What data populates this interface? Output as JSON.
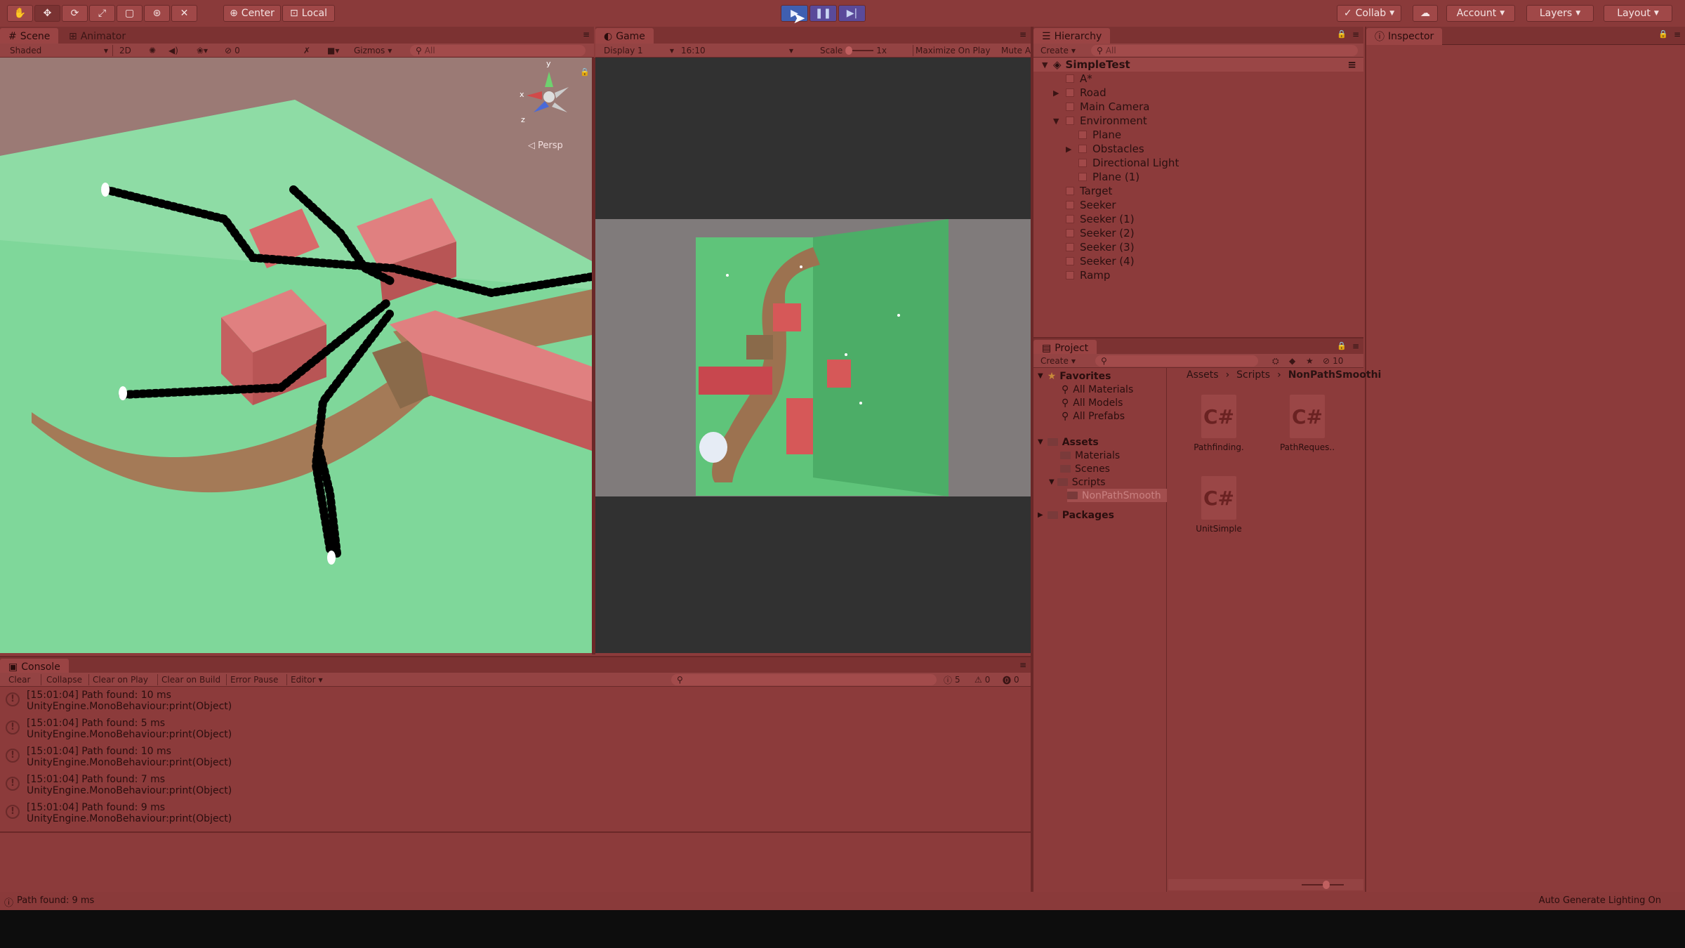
{
  "toolbar": {
    "tools": [
      "hand-tool",
      "move-tool",
      "rotate-tool",
      "scale-tool",
      "rect-tool",
      "transform-tool",
      "custom-tool"
    ],
    "pivot_label": "Center",
    "space_label": "Local",
    "collab_label": "Collab",
    "account_label": "Account",
    "layers_label": "Layers",
    "layout_label": "Layout"
  },
  "scene": {
    "tab_scene": "Scene",
    "tab_animator": "Animator",
    "shading": "Shaded",
    "mode_2d": "2D",
    "fx_count": "0",
    "gizmos": "Gizmos",
    "search_placeholder": "All",
    "persp_label": "Persp",
    "axis_x": "x",
    "axis_y": "y",
    "axis_z": "z"
  },
  "game": {
    "tab": "Game",
    "display": "Display 1",
    "aspect": "16:10",
    "scale_label": "Scale",
    "scale_value": "1x",
    "maximize": "Maximize On Play",
    "mute": "Mute A"
  },
  "hierarchy": {
    "tab": "Hierarchy",
    "create": "Create",
    "search_placeholder": "All",
    "scene_name": "SimpleTest",
    "items": [
      "A*",
      "Road",
      "Main Camera",
      "Environment",
      "Plane",
      "Obstacles",
      "Directional Light",
      "Plane (1)",
      "Target",
      "Seeker",
      "Seeker (1)",
      "Seeker (2)",
      "Seeker (3)",
      "Seeker (4)",
      "Ramp"
    ]
  },
  "inspector": {
    "tab": "Inspector"
  },
  "project": {
    "tab": "Project",
    "create": "Create",
    "count": "10",
    "favorites_label": "Favorites",
    "favorites": [
      "All Materials",
      "All Models",
      "All Prefabs"
    ],
    "assets_label": "Assets",
    "folders": [
      "Materials",
      "Scenes",
      "Scripts",
      "NonPathSmooth"
    ],
    "packages_label": "Packages",
    "breadcrumb": [
      "Assets",
      "Scripts",
      "NonPathSmoothi"
    ],
    "files": [
      "Pathfinding.",
      "PathReques..",
      "UnitSimple"
    ],
    "file_icon_text": "C#"
  },
  "console": {
    "tab": "Console",
    "buttons": [
      "Clear",
      "Collapse",
      "Clear on Play",
      "Clear on Build",
      "Error Pause",
      "Editor"
    ],
    "info_count": "5",
    "warn_count": "0",
    "error_count": "0",
    "rows": [
      {
        "line1": "[15:01:04] Path found: 10 ms",
        "line2": "UnityEngine.MonoBehaviour:print(Object)"
      },
      {
        "line1": "[15:01:04] Path found: 5 ms",
        "line2": "UnityEngine.MonoBehaviour:print(Object)"
      },
      {
        "line1": "[15:01:04] Path found: 10 ms",
        "line2": "UnityEngine.MonoBehaviour:print(Object)"
      },
      {
        "line1": "[15:01:04] Path found: 7 ms",
        "line2": "UnityEngine.MonoBehaviour:print(Object)"
      },
      {
        "line1": "[15:01:04] Path found: 9 ms",
        "line2": "UnityEngine.MonoBehaviour:print(Object)"
      }
    ]
  },
  "status": {
    "message": "Path found: 9 ms",
    "right": "Auto Generate Lighting On"
  },
  "colors": {
    "panel": "#8c3b3b",
    "ground": "#7fd79a",
    "building": "#d96a6a",
    "road": "#9c7250",
    "path": "#000000"
  }
}
